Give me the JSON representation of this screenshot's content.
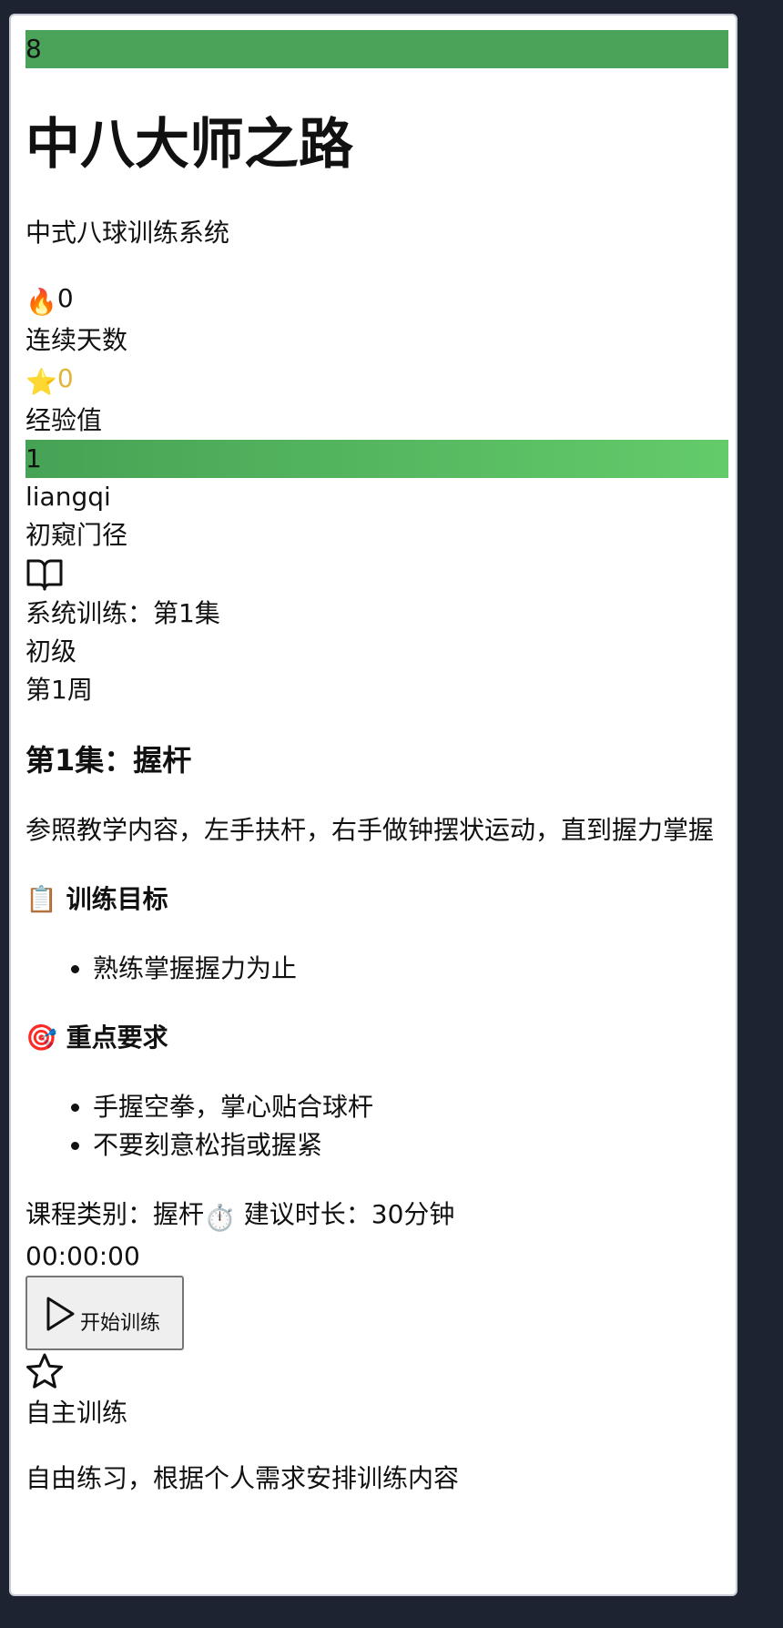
{
  "header": {
    "top_bar_value": "8",
    "title": "中八大师之路",
    "subtitle": "中式八球训练系统"
  },
  "stats": {
    "streak_emoji": "🔥",
    "streak_value": "0",
    "streak_label": "连续天数",
    "xp_emoji": "⭐",
    "xp_value": "0",
    "xp_label": "经验值"
  },
  "profile": {
    "level_value": "1",
    "username": "liangqi",
    "rank": "初窥门径"
  },
  "lesson": {
    "series": "系统训练：第1集",
    "difficulty": "初级",
    "week": "第1周",
    "title": "第1集：握杆",
    "description": "参照教学内容，左手扶杆，右手做钟摆状运动，直到握力掌握",
    "goals_icon": "📋",
    "goals_heading": "训练目标",
    "goals": [
      "熟练掌握握力为止"
    ],
    "requirements_icon": "🎯",
    "requirements_heading": "重点要求",
    "requirements": [
      "手握空拳，掌心贴合球杆",
      "不要刻意松指或握紧"
    ],
    "category_text": "课程类别：握杆",
    "timer_emoji": "⏱️",
    "duration_text": "建议时长：30分钟",
    "timer": "00:00:00",
    "start_button": "开始训练"
  },
  "free_training": {
    "title": "自主训练",
    "description": "自由练习，根据个人需求安排训练内容"
  },
  "icons": {
    "lesson": "book-open-icon",
    "start": "play-icon",
    "free": "star-icon"
  },
  "colors": {
    "background": "#1e2332",
    "progress_green": "#4aa358",
    "level_gradient_end": "#64cb6a",
    "xp_gold": "#e2b43a"
  }
}
